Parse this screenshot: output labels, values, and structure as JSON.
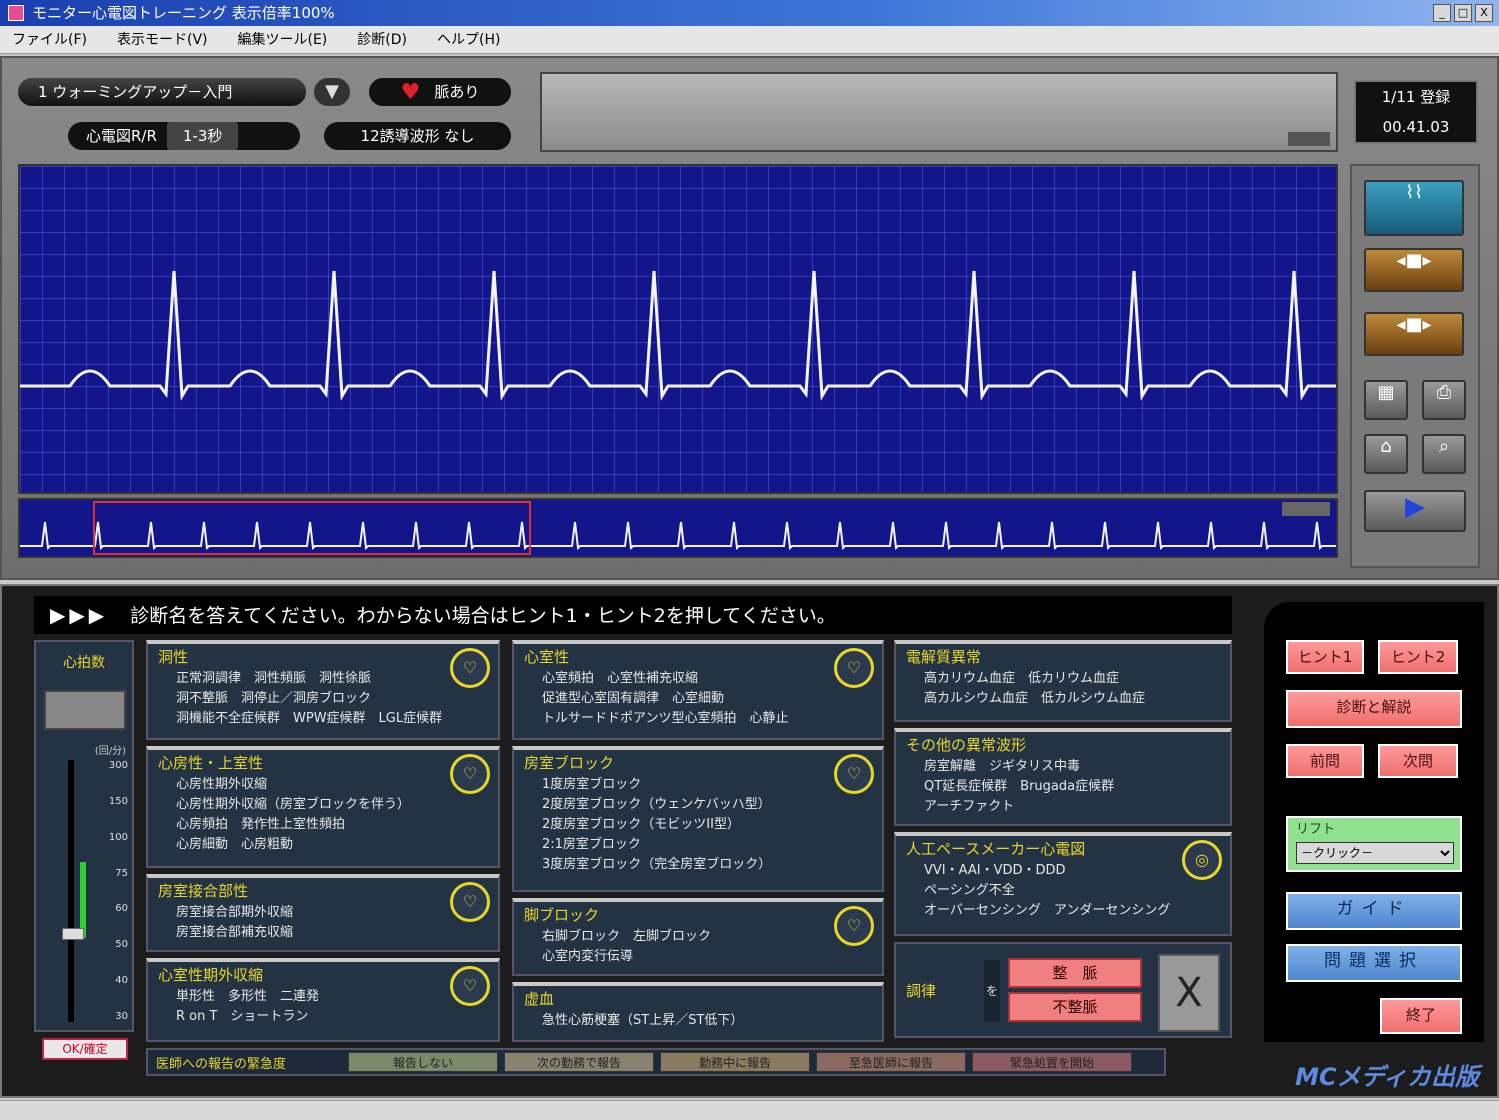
{
  "window": {
    "title": "モニター心電図トレーニング 表示倍率100%",
    "btn_min": "_",
    "btn_max": "□",
    "btn_close": "X"
  },
  "menu": {
    "items": [
      "ファイル(F)",
      "表示モード(V)",
      "編集ツール(E)",
      "診断(D)",
      "ヘルプ(H)"
    ]
  },
  "header": {
    "lesson": "1 ウォーミングアップ－入門",
    "heart_label": "脈あり",
    "heart_rate_label": "心電図R/R",
    "heart_rate_value": "1-3秒",
    "lead_label": "12誘導波形",
    "lead_value": "なし",
    "date_top": "1/11 登録",
    "date_bottom": "00.41.03"
  },
  "instruction": {
    "arrows": "▶▶▶",
    "text": "診断名を答えてください。わからない場合はヒント1・ヒント2を押してください。"
  },
  "heart_rate_panel": {
    "title": "心拍数",
    "unit": "(回/分)",
    "scale": [
      "300",
      "150",
      "100",
      "75",
      "60",
      "50",
      "40",
      "30"
    ],
    "ok": "OK/確定"
  },
  "categories": {
    "c1": {
      "title": "洞性",
      "lines": [
        "正常洞調律　洞性頻脈　洞性徐脈",
        "洞不整脈　洞停止／洞房ブロック",
        "洞機能不全症候群　WPW症候群　LGL症候群"
      ]
    },
    "c2": {
      "title": "心房性・上室性",
      "lines": [
        "心房性期外収縮",
        "心房性期外収縮（房室ブロックを伴う）",
        "心房頻拍　発作性上室性頻拍",
        "心房細動　心房粗動"
      ]
    },
    "c3": {
      "title": "房室接合部性",
      "lines": [
        "房室接合部期外収縮",
        "房室接合部補充収縮"
      ]
    },
    "c4": {
      "title": "心室性期外収縮",
      "lines": [
        "単形性　多形性　二連発",
        "R on T　ショートラン"
      ]
    },
    "c5": {
      "title": "心室性",
      "lines": [
        "心室頻拍　心室性補充収縮",
        "促進型心室固有調律　心室細動",
        "トルサードドポアンツ型心室頻拍　心静止"
      ]
    },
    "c6": {
      "title": "房室ブロック",
      "lines": [
        "1度房室ブロック",
        "2度房室ブロック（ウェンケバッハ型）",
        "2度房室ブロック（モビッツII型）",
        "2:1房室ブロック",
        "3度房室ブロック（完全房室ブロック）"
      ]
    },
    "c7": {
      "title": "脚ブロック",
      "lines": [
        "右脚ブロック　左脚ブロック",
        "心室内変行伝導"
      ]
    },
    "c8": {
      "title": "虚血",
      "lines": [
        "急性心筋梗塞（ST上昇／ST低下）"
      ]
    },
    "c9": {
      "title": "電解質異常",
      "lines": [
        "高カリウム血症　低カリウム血症",
        "高カルシウム血症　低カルシウム血症"
      ]
    },
    "c10": {
      "title": "その他の異常波形",
      "lines": [
        "房室解離　ジギタリス中毒",
        "QT延長症候群　Brugada症候群",
        "アーチファクト"
      ]
    },
    "c11": {
      "title": "人工ペースメーカー心電図",
      "lines": [
        "VVI・AAI・VDD・DDD",
        "ペーシング不全",
        "オーバーセンシング　アンダーセンシング"
      ]
    }
  },
  "rhythm": {
    "label": "調律",
    "sep": "を",
    "regular": "整　脈",
    "irregular": "不整脈",
    "clear": "X"
  },
  "bottom_row": {
    "label": "医師への報告の緊急度",
    "options": [
      "報告しない",
      "次の勤務で報告",
      "勤務中に報告",
      "至急医師に報告",
      "緊急処置を開始"
    ]
  },
  "right_panel": {
    "hint1": "ヒント1",
    "hint2": "ヒント2",
    "answer": "診断と解説",
    "prev": "前問",
    "next": "次問",
    "lift_label": "リフト",
    "lift_select": "－クリック－",
    "guide": "ガイド",
    "select": "問題選択",
    "exit": "終了"
  },
  "logo": "MCメディカ出版",
  "colors": {
    "ecg_bg": "#12168a",
    "label_yellow": "#e8d628",
    "button_red": "#f08080",
    "button_blue": "#4f86cf"
  },
  "ecg": {
    "rr_count": 9
  }
}
